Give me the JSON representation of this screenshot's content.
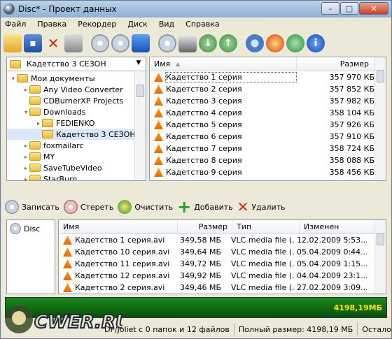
{
  "window": {
    "title": "Disc* - Проект данных",
    "min": "–",
    "max": "□",
    "close": "✕"
  },
  "menu": [
    "Файл",
    "Правка",
    "Рекордер",
    "Диск",
    "Вид",
    "Справка"
  ],
  "toolbar_icons": [
    "new-folder-icon",
    "save-icon",
    "delete-icon",
    "print-icon",
    "disc-remove-icon",
    "disc-check-icon",
    "window-icon",
    "disc-info-icon",
    "drive-icon",
    "download-icon",
    "upload-icon",
    "settings-icon",
    "burn-icon",
    "magnify-icon",
    "info-icon"
  ],
  "folder_combo": {
    "value": "Кадетство 3 СЕЗОН"
  },
  "tree": [
    {
      "label": "Мои документы",
      "depth": 0,
      "exp": "▾"
    },
    {
      "label": "Any Video Converter",
      "depth": 1,
      "exp": "▸"
    },
    {
      "label": "CDBurnerXP Projects",
      "depth": 1,
      "exp": ""
    },
    {
      "label": "Downloads",
      "depth": 1,
      "exp": "▾"
    },
    {
      "label": "FEDIENKO",
      "depth": 2,
      "exp": "▸"
    },
    {
      "label": "Кадетство 3 СЕЗОН",
      "depth": 2,
      "exp": ""
    },
    {
      "label": "foxmailarc",
      "depth": 1,
      "exp": "▸"
    },
    {
      "label": "MY",
      "depth": 1,
      "exp": "▸"
    },
    {
      "label": "SaveTubeVideo",
      "depth": 1,
      "exp": "▸"
    },
    {
      "label": "StarBurn",
      "depth": 1,
      "exp": "▸"
    }
  ],
  "source_list": {
    "col_name": "Имя",
    "col_size": "Размер",
    "rows": [
      {
        "name": "Кадетство 1 серия",
        "size": "357 970 КБ"
      },
      {
        "name": "Кадетство 2 серия",
        "size": "357 852 КБ"
      },
      {
        "name": "Кадетство 3 серия",
        "size": "357 982 КБ"
      },
      {
        "name": "Кадетство 4 серия",
        "size": "358 104 КБ"
      },
      {
        "name": "Кадетство 5 серия",
        "size": "357 926 КБ"
      },
      {
        "name": "Кадетство 6 серия",
        "size": "357 910 КБ"
      },
      {
        "name": "Кадетство 7 серия",
        "size": "358 724 КБ"
      },
      {
        "name": "Кадетство 8 серия",
        "size": "358 088 КБ"
      },
      {
        "name": "Кадетство 9 серия",
        "size": "358 456 КБ"
      }
    ]
  },
  "actions": {
    "write": "Записать",
    "erase": "Стереть",
    "clear": "Очистить",
    "add": "Добавить",
    "remove": "Удалить"
  },
  "drive": {
    "label": "Disc"
  },
  "compilation": {
    "col_name": "Имя",
    "col_size": "Размер",
    "col_type": "Тип",
    "col_modified": "Изменен",
    "rows": [
      {
        "name": "Кадетство 1 серия.avi",
        "size": "349,58 МБ",
        "type": "VLC media file (...",
        "modified": "12.02.2009 5:53..."
      },
      {
        "name": "Кадетство 10 серия.avi",
        "size": "349,64 МБ",
        "type": "VLC media file (...",
        "modified": "05.04.2009 0:44..."
      },
      {
        "name": "Кадетство 11 серия.avi",
        "size": "349,72 МБ",
        "type": "VLC media file (...",
        "modified": "05.04.2009 1:15..."
      },
      {
        "name": "Кадетство 12 серия.avi",
        "size": "349,92 МБ",
        "type": "VLC media file (...",
        "modified": "04.04.2009 23:1..."
      },
      {
        "name": "Кадетство 2 серия.avi",
        "size": "349,46 МБ",
        "type": "VLC media file (...",
        "modified": "27.02.2009 3:09..."
      }
    ]
  },
  "capacity": {
    "value": "4198,19МБ",
    "fill_fraction": 1.0
  },
  "status": {
    "info": "DF/Joliet с 0 папок и 12 файлов",
    "total": "Полный размер: 4198,19 МБ",
    "remaining": "Осталось: н/д"
  },
  "logo_text": "CWER.RU"
}
